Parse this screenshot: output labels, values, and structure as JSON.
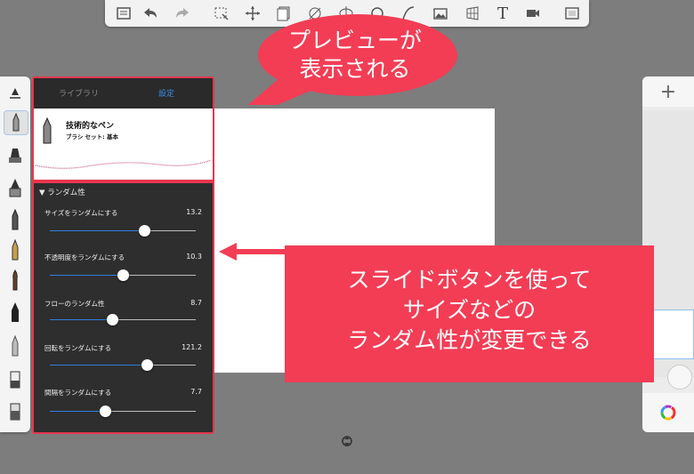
{
  "colors": {
    "accent_red": "#f23d55",
    "panel_border": "#e8364d",
    "slider_blue": "#2f7fe0",
    "tab_active": "#3a8ee6"
  },
  "toolbar": {
    "icons": [
      "list-icon",
      "undo-icon",
      "redo-icon",
      "selection-icon",
      "transform-icon",
      "layer-icon",
      "ruler-icon",
      "symmetry-icon",
      "shape-icon",
      "curve-icon",
      "image-icon",
      "perspective-icon",
      "text-icon",
      "video-icon",
      "fullscreen-icon"
    ],
    "text_tool_label": "T"
  },
  "brush_panel": {
    "tabs": {
      "library": "ライブラリ",
      "settings": "設定"
    },
    "brush_name": "技術的なペン",
    "brush_set": "ブラシ セット: 基本",
    "section_title": "ランダム性",
    "section_arrow": "▼",
    "sliders": [
      {
        "label": "サイズをランダムにする",
        "value": "13.2",
        "level": 0.65
      },
      {
        "label": "不透明度をランダムにする",
        "value": "10.3",
        "level": 0.5
      },
      {
        "label": "フローのランダム性",
        "value": "8.7",
        "level": 0.43
      },
      {
        "label": "回転をランダムにする",
        "value": "121.2",
        "level": 0.67
      },
      {
        "label": "間隔をランダムにする",
        "value": "7.7",
        "level": 0.38
      }
    ]
  },
  "right_panel": {
    "add_label": "+"
  },
  "callouts": {
    "bubble_line1": "プレビューが",
    "bubble_line2": "表示される",
    "note_line1": "スライドボタンを使って",
    "note_line2": "サイズなどの",
    "note_line3": "ランダム性が変更できる"
  }
}
